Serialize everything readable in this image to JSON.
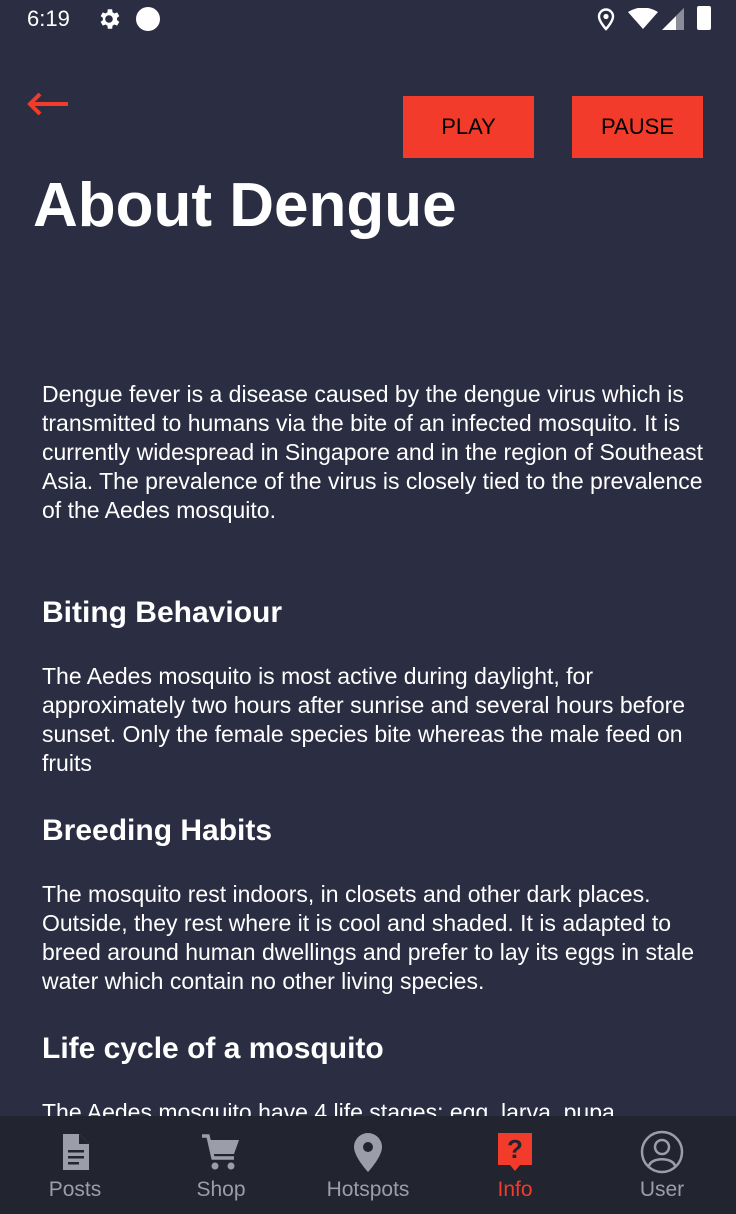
{
  "status_bar": {
    "time": "6:19"
  },
  "controls": {
    "play_label": "PLAY",
    "pause_label": "PAUSE"
  },
  "page": {
    "title": "About Dengue"
  },
  "content": {
    "intro": "Dengue fever is a disease caused by the dengue virus which is transmitted to humans via the bite of an infected mosquito. It is currently widespread in Singapore and in the region of Southeast Asia. The prevalence of the virus is closely tied to the prevalence of the Aedes mosquito.",
    "sections": [
      {
        "heading": "Biting Behaviour",
        "text": "The Aedes mosquito is most active during daylight, for approximately two hours after sunrise and several hours before sunset. Only the female species bite whereas the male feed on fruits"
      },
      {
        "heading": "Breeding Habits",
        "text": "The mosquito rest indoors, in closets and other dark places. Outside, they rest where it is cool and shaded. It is adapted to breed around human dwellings and prefer to lay its eggs in stale water which contain no other living species."
      },
      {
        "heading": "Life cycle of a mosquito",
        "text": "The Aedes mosquito have 4 life stages: egg, larva, pupa"
      }
    ]
  },
  "nav": {
    "items": [
      {
        "label": "Posts",
        "icon": "document-icon",
        "active": false
      },
      {
        "label": "Shop",
        "icon": "cart-icon",
        "active": false
      },
      {
        "label": "Hotspots",
        "icon": "location-pin-icon",
        "active": false
      },
      {
        "label": "Info",
        "icon": "question-icon",
        "active": true
      },
      {
        "label": "User",
        "icon": "user-icon",
        "active": false
      }
    ],
    "active_color": "#f23b2a",
    "inactive_color": "#9b9ea8"
  },
  "colors": {
    "background": "#2b2e42",
    "accent": "#f23b2a",
    "nav_background": "#22242f"
  }
}
